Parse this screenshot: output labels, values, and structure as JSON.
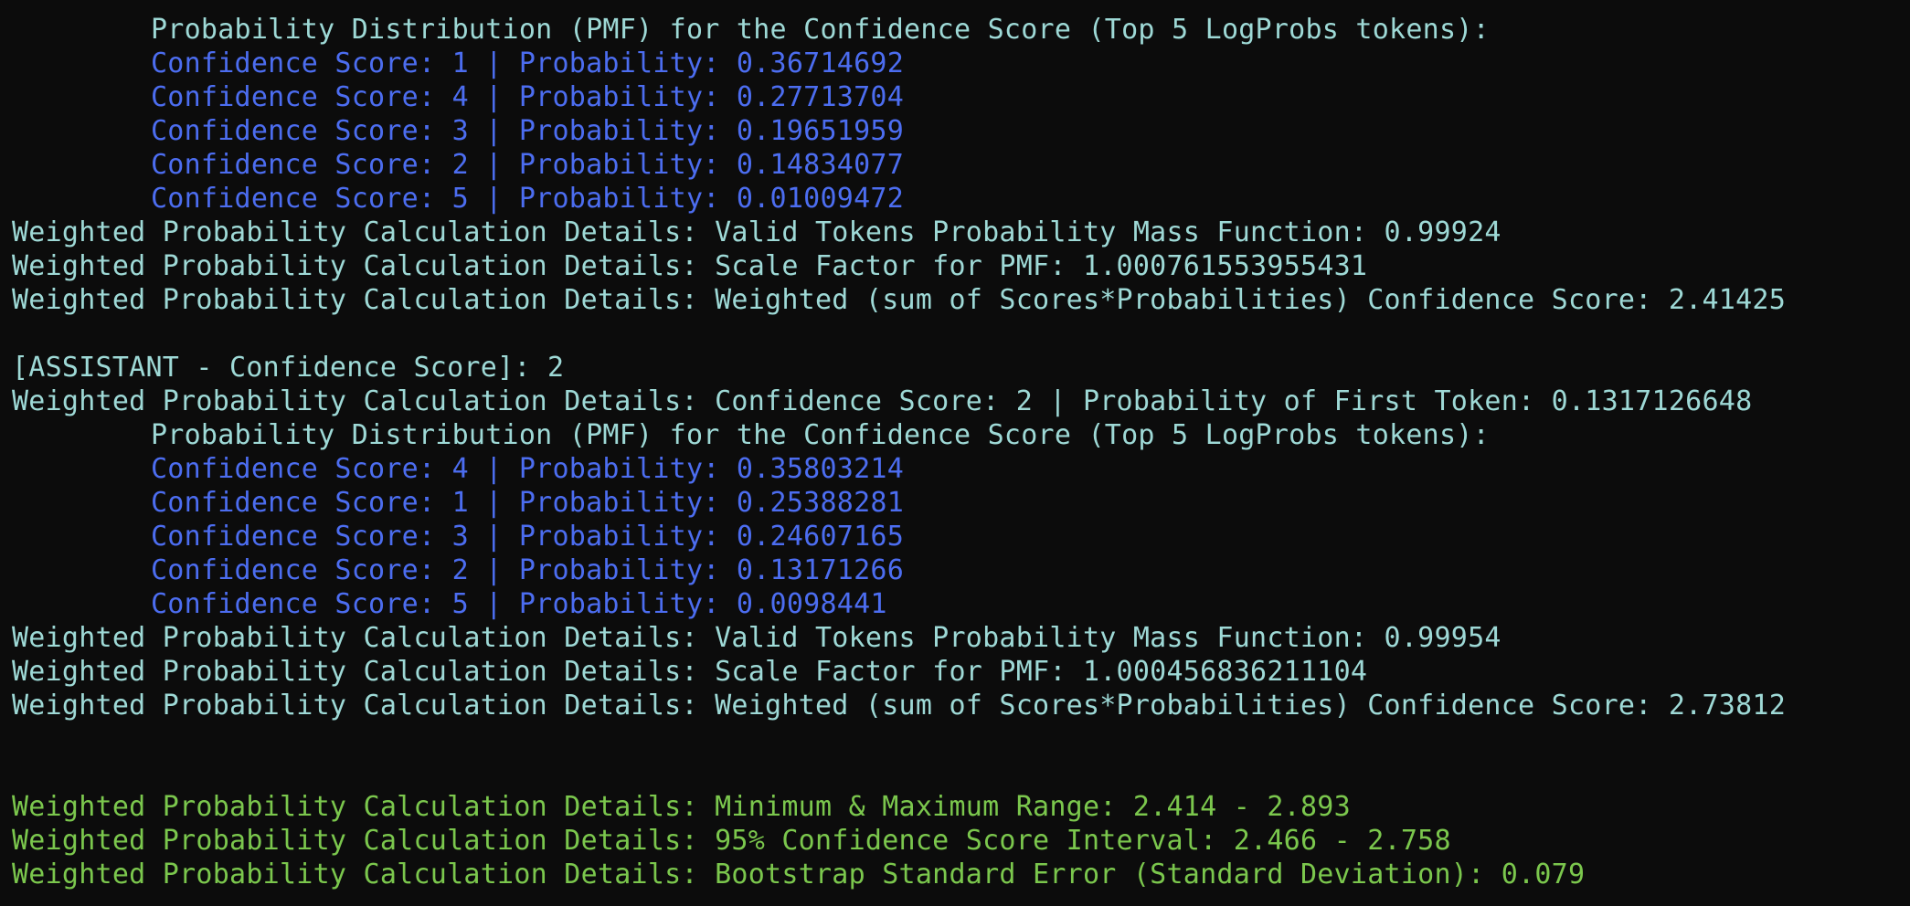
{
  "colors": {
    "background": "#0c0c0c",
    "cyan": "#9ed9d6",
    "blue": "#4c6df0",
    "green": "#7bc74d"
  },
  "lines": [
    {
      "text": "Probability Distribution (PMF) for the Confidence Score (Top 5 LogProbs tokens):",
      "color": "cyan",
      "indent": 1
    },
    {
      "text": "Confidence Score: 1 | Probability: 0.36714692",
      "color": "blue",
      "indent": 1
    },
    {
      "text": "Confidence Score: 4 | Probability: 0.27713704",
      "color": "blue",
      "indent": 1
    },
    {
      "text": "Confidence Score: 3 | Probability: 0.19651959",
      "color": "blue",
      "indent": 1
    },
    {
      "text": "Confidence Score: 2 | Probability: 0.14834077",
      "color": "blue",
      "indent": 1
    },
    {
      "text": "Confidence Score: 5 | Probability: 0.01009472",
      "color": "blue",
      "indent": 1
    },
    {
      "text": "Weighted Probability Calculation Details: Valid Tokens Probability Mass Function: 0.99924",
      "color": "cyan",
      "indent": 0
    },
    {
      "text": "Weighted Probability Calculation Details: Scale Factor for PMF: 1.000761553955431",
      "color": "cyan",
      "indent": 0
    },
    {
      "text": "Weighted Probability Calculation Details: Weighted (sum of Scores*Probabilities) Confidence Score: 2.41425",
      "color": "cyan",
      "indent": 0
    },
    {
      "text": "",
      "color": "cyan",
      "indent": 0
    },
    {
      "text": "[ASSISTANT - Confidence Score]: 2",
      "color": "cyan",
      "indent": 0
    },
    {
      "text": "Weighted Probability Calculation Details: Confidence Score: 2 | Probability of First Token: 0.1317126648",
      "color": "cyan",
      "indent": 0
    },
    {
      "text": "Probability Distribution (PMF) for the Confidence Score (Top 5 LogProbs tokens):",
      "color": "cyan",
      "indent": 1
    },
    {
      "text": "Confidence Score: 4 | Probability: 0.35803214",
      "color": "blue",
      "indent": 1
    },
    {
      "text": "Confidence Score: 1 | Probability: 0.25388281",
      "color": "blue",
      "indent": 1
    },
    {
      "text": "Confidence Score: 3 | Probability: 0.24607165",
      "color": "blue",
      "indent": 1
    },
    {
      "text": "Confidence Score: 2 | Probability: 0.13171266",
      "color": "blue",
      "indent": 1
    },
    {
      "text": "Confidence Score: 5 | Probability: 0.0098441",
      "color": "blue",
      "indent": 1
    },
    {
      "text": "Weighted Probability Calculation Details: Valid Tokens Probability Mass Function: 0.99954",
      "color": "cyan",
      "indent": 0
    },
    {
      "text": "Weighted Probability Calculation Details: Scale Factor for PMF: 1.000456836211104",
      "color": "cyan",
      "indent": 0
    },
    {
      "text": "Weighted Probability Calculation Details: Weighted (sum of Scores*Probabilities) Confidence Score: 2.73812",
      "color": "cyan",
      "indent": 0
    },
    {
      "text": "",
      "color": "cyan",
      "indent": 0
    },
    {
      "text": "",
      "color": "cyan",
      "indent": 0
    },
    {
      "text": "Weighted Probability Calculation Details: Minimum & Maximum Range: 2.414 - 2.893",
      "color": "green",
      "indent": 0
    },
    {
      "text": "Weighted Probability Calculation Details: 95% Confidence Score Interval: 2.466 - 2.758",
      "color": "green",
      "indent": 0
    },
    {
      "text": "Weighted Probability Calculation Details: Bootstrap Standard Error (Standard Deviation): 0.079",
      "color": "green",
      "indent": 0
    }
  ]
}
